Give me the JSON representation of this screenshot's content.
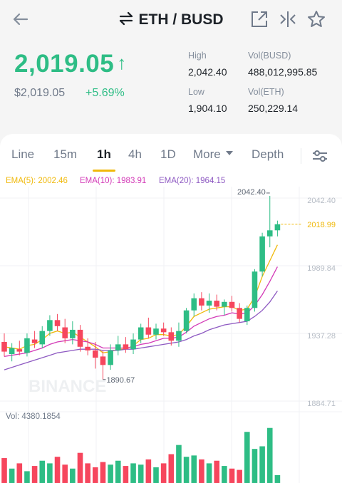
{
  "header": {
    "pair": "ETH / BUSD",
    "icons": [
      "back-arrow-icon",
      "swap-arrows-icon",
      "share-icon",
      "compare-icon",
      "star-icon"
    ]
  },
  "price": {
    "last": "2,019.05",
    "fiat": "$2,019.05",
    "change": "+5.69%",
    "up_arrow": "↑",
    "color_up": "#2ebd85",
    "color_down": "#f6465d"
  },
  "stats": {
    "high_label": "High",
    "high_value": "2,042.40",
    "low_label": "Low",
    "low_value": "1,904.10",
    "vol_busd_label": "Vol(BUSD)",
    "vol_busd_value": "488,012,995.85",
    "vol_eth_label": "Vol(ETH)",
    "vol_eth_value": "250,229.14"
  },
  "tabs": {
    "line": "Line",
    "m15": "15m",
    "h1": "1h",
    "h4": "4h",
    "d1": "1D",
    "more": "More",
    "depth": "Depth",
    "active": "1h"
  },
  "ema": {
    "ema5": "EMA(5): 2002.46",
    "ema10": "EMA(10): 1983.91",
    "ema20": "EMA(20): 1964.15",
    "ema5_color": "#f0b90b",
    "ema10_color": "#d33ab7",
    "ema20_color": "#8e5ac2"
  },
  "chart": {
    "axis_labels": [
      "2042.40",
      "1989.84",
      "1937.28",
      "1884.71"
    ],
    "high_marker": "2042.40",
    "low_marker": "1890.67",
    "last_price_tag": "2018.99",
    "volume_label": "Vol: 4380.1854",
    "watermark": "BINANCE"
  },
  "chart_data": {
    "type": "candlestick",
    "ylim": [
      1875,
      2050
    ],
    "candles": [
      {
        "o": 1922,
        "h": 1929,
        "l": 1910,
        "c": 1914
      },
      {
        "o": 1912,
        "h": 1921,
        "l": 1906,
        "c": 1917
      },
      {
        "o": 1916,
        "h": 1923,
        "l": 1911,
        "c": 1914
      },
      {
        "o": 1913,
        "h": 1929,
        "l": 1910,
        "c": 1925
      },
      {
        "o": 1924,
        "h": 1931,
        "l": 1917,
        "c": 1921
      },
      {
        "o": 1920,
        "h": 1935,
        "l": 1917,
        "c": 1931
      },
      {
        "o": 1931,
        "h": 1944,
        "l": 1927,
        "c": 1940
      },
      {
        "o": 1940,
        "h": 1945,
        "l": 1931,
        "c": 1935
      },
      {
        "o": 1934,
        "h": 1941,
        "l": 1921,
        "c": 1925
      },
      {
        "o": 1925,
        "h": 1939,
        "l": 1920,
        "c": 1932
      },
      {
        "o": 1932,
        "h": 1936,
        "l": 1914,
        "c": 1918
      },
      {
        "o": 1918,
        "h": 1925,
        "l": 1911,
        "c": 1915
      },
      {
        "o": 1915,
        "h": 1922,
        "l": 1900,
        "c": 1909
      },
      {
        "o": 1910,
        "h": 1915,
        "l": 1891,
        "c": 1903
      },
      {
        "o": 1903,
        "h": 1920,
        "l": 1899,
        "c": 1915
      },
      {
        "o": 1915,
        "h": 1927,
        "l": 1911,
        "c": 1920
      },
      {
        "o": 1920,
        "h": 1926,
        "l": 1913,
        "c": 1916
      },
      {
        "o": 1916,
        "h": 1929,
        "l": 1912,
        "c": 1924
      },
      {
        "o": 1924,
        "h": 1937,
        "l": 1921,
        "c": 1934
      },
      {
        "o": 1934,
        "h": 1942,
        "l": 1925,
        "c": 1928
      },
      {
        "o": 1928,
        "h": 1937,
        "l": 1924,
        "c": 1933
      },
      {
        "o": 1933,
        "h": 1938,
        "l": 1927,
        "c": 1930
      },
      {
        "o": 1930,
        "h": 1934,
        "l": 1919,
        "c": 1923
      },
      {
        "o": 1923,
        "h": 1938,
        "l": 1918,
        "c": 1931
      },
      {
        "o": 1931,
        "h": 1950,
        "l": 1929,
        "c": 1948
      },
      {
        "o": 1948,
        "h": 1962,
        "l": 1943,
        "c": 1958
      },
      {
        "o": 1958,
        "h": 1963,
        "l": 1948,
        "c": 1952
      },
      {
        "o": 1952,
        "h": 1962,
        "l": 1946,
        "c": 1956
      },
      {
        "o": 1956,
        "h": 1961,
        "l": 1948,
        "c": 1951
      },
      {
        "o": 1951,
        "h": 1957,
        "l": 1944,
        "c": 1955
      },
      {
        "o": 1955,
        "h": 1960,
        "l": 1947,
        "c": 1950
      },
      {
        "o": 1950,
        "h": 1954,
        "l": 1938,
        "c": 1941
      },
      {
        "o": 1939,
        "h": 1952,
        "l": 1936,
        "c": 1950
      },
      {
        "o": 1950,
        "h": 1982,
        "l": 1947,
        "c": 1980
      },
      {
        "o": 1980,
        "h": 2012,
        "l": 1976,
        "c": 2009
      },
      {
        "o": 2009,
        "h": 2042.4,
        "l": 2000,
        "c": 2014
      },
      {
        "o": 2014,
        "h": 2022,
        "l": 2009,
        "c": 2019
      }
    ],
    "ema5": [
      1918,
      1917,
      1916,
      1919,
      1920,
      1924,
      1929,
      1931,
      1929,
      1930,
      1926,
      1922,
      1918,
      1913,
      1914,
      1916,
      1916,
      1919,
      1924,
      1925,
      1928,
      1928,
      1927,
      1928,
      1935,
      1943,
      1946,
      1949,
      1950,
      1951,
      1951,
      1948,
      1949,
      1959,
      1976,
      1989,
      2002
    ],
    "ema10": [
      1910,
      1911,
      1912,
      1913,
      1915,
      1917,
      1920,
      1922,
      1923,
      1924,
      1923,
      1922,
      1920,
      1917,
      1917,
      1917,
      1917,
      1918,
      1920,
      1921,
      1923,
      1925,
      1925,
      1926,
      1930,
      1935,
      1938,
      1941,
      1943,
      1944,
      1946,
      1945,
      1946,
      1952,
      1961,
      1972,
      1984
    ],
    "ema20": [
      1899,
      1901,
      1903,
      1905,
      1907,
      1909,
      1911,
      1913,
      1914,
      1915,
      1916,
      1916,
      1916,
      1915,
      1915,
      1915,
      1916,
      1916,
      1917,
      1918,
      1919,
      1920,
      1921,
      1922,
      1924,
      1927,
      1929,
      1932,
      1934,
      1936,
      1937,
      1938,
      1939,
      1943,
      1948,
      1955,
      1964
    ],
    "volume": [
      38,
      22,
      30,
      18,
      26,
      34,
      30,
      40,
      28,
      22,
      46,
      30,
      24,
      32,
      28,
      34,
      26,
      30,
      28,
      36,
      24,
      30,
      44,
      58,
      40,
      42,
      36,
      30,
      34,
      26,
      22,
      20,
      78,
      52,
      56,
      84,
      12
    ]
  }
}
